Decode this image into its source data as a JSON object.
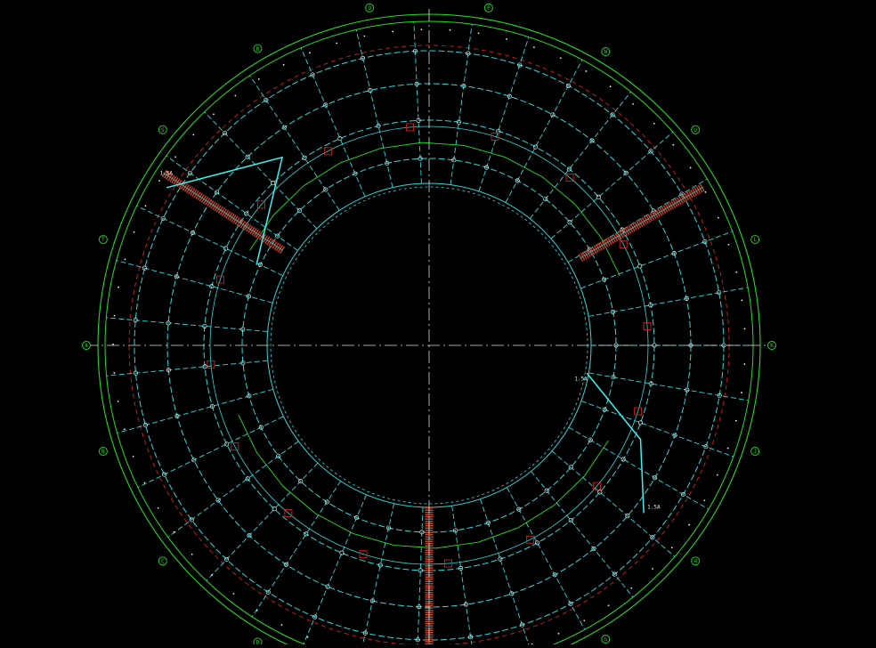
{
  "drawing": {
    "background": "#000000",
    "colors": {
      "axis_ring": "#22dd22",
      "grid": "#2fd8d8",
      "red_dash": "#cc2222",
      "centerline": "#dddddd",
      "stair": "#c0402a",
      "leader": "#40f0f0",
      "marker": "#f0f0f0"
    },
    "center_label": "",
    "axis_bubbles": [
      {
        "label": "O",
        "angle": 100
      },
      {
        "label": "P",
        "angle": 80
      },
      {
        "label": "N",
        "angle": 59
      },
      {
        "label": "U",
        "angle": 39
      },
      {
        "label": "L",
        "angle": 18
      },
      {
        "label": "K",
        "angle": 0
      },
      {
        "label": "J",
        "angle": -18
      },
      {
        "label": "H",
        "angle": -39
      },
      {
        "label": "G",
        "angle": -59
      },
      {
        "label": "D",
        "angle": -120
      },
      {
        "label": "C",
        "angle": -141
      },
      {
        "label": "B",
        "angle": -162
      },
      {
        "label": "A",
        "angle": 180
      },
      {
        "label": "T",
        "angle": 162
      },
      {
        "label": "S",
        "angle": 141
      },
      {
        "label": "R",
        "angle": 120
      }
    ],
    "callouts": [
      {
        "text": "1.5A",
        "angle": 147
      },
      {
        "text": "1.5A",
        "angle": -13
      },
      {
        "text": "1.5A",
        "angle": -36
      }
    ]
  }
}
